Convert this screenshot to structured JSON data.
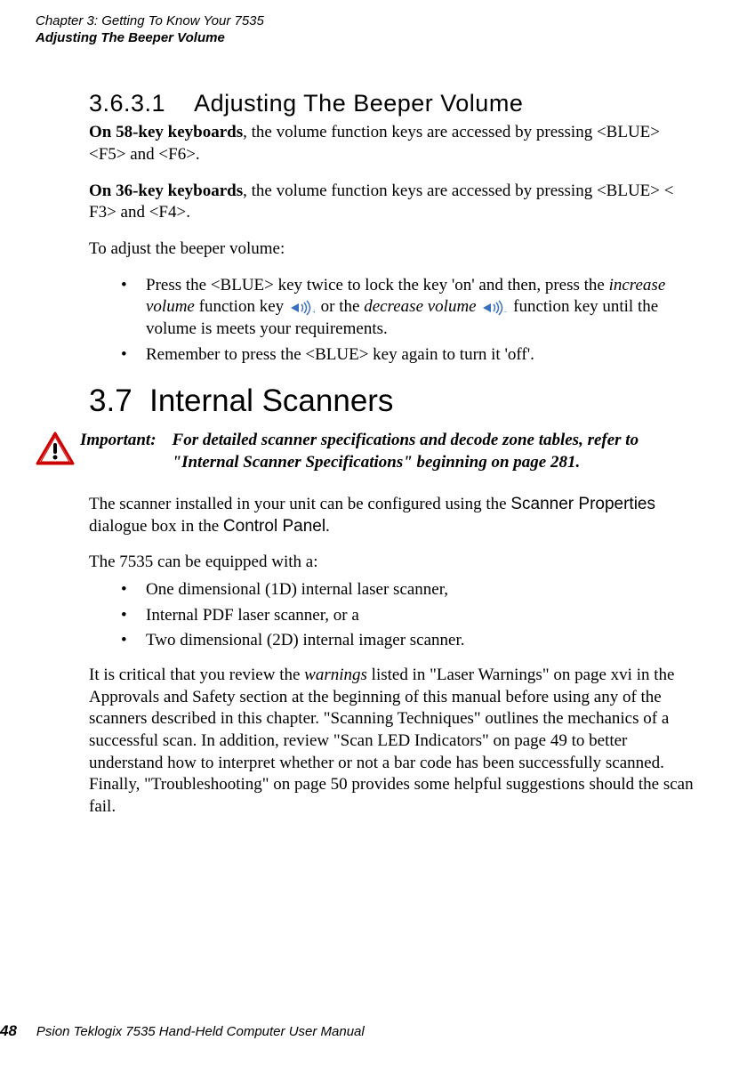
{
  "header": {
    "chapter": "Chapter 3: Getting To Know Your 7535",
    "section": "Adjusting The Beeper Volume"
  },
  "sub": {
    "num": "3.6.3.1",
    "title": "Adjusting The Beeper Volume"
  },
  "p58_bold": "On 58-key keyboards",
  "p58_rest": ", the volume function keys are accessed by pressing <BLUE> <F5> and <F6>.",
  "p36_bold": "On 36-key keyboards",
  "p36_rest": ", the volume function keys are accessed by pressing <BLUE> < F3> and <F4>.",
  "adjust": "To adjust the beeper volume:",
  "b1_a": "Press the <BLUE> key twice to lock the key 'on' and then, press the ",
  "b1_inc": "increase volume",
  "b1_b": " function key ",
  "b1_c": " or the ",
  "b1_dec": "decrease volume",
  "b1_d": " function key until the volume is meets your requirements.",
  "b2": "Remember to press the <BLUE> key again to turn it 'off'.",
  "sec": {
    "num": "3.7",
    "title": "Internal Scanners"
  },
  "imp_label": "Important:",
  "imp_body": "For detailed scanner specifications and decode zone tables, refer to \"Internal Scanner Specifications\" beginning on page 281.",
  "scanner_p1_a": "The scanner installed in your unit can be configured using the ",
  "scanner_p1_b": "Scanner Properties",
  "scanner_p1_c": " dialogue box in the ",
  "scanner_p1_d": "Control Panel",
  "scanner_p1_e": ".",
  "equip": "The 7535 can be equipped with a:",
  "el1": "One dimensional (1D) internal laser scanner,",
  "el2": "Internal PDF laser scanner, or a",
  "el3": "Two dimensional (2D) internal imager scanner.",
  "warn_a": "It is critical that you review the ",
  "warn_b": "warnings",
  "warn_c": " listed in \"Laser Warnings\" on page xvi in the Approvals and Safety section at the beginning of this manual before using any of the scanners described in this chapter. \"Scanning Techniques\" outlines the mechanics of a successful scan. In addition, review \"Scan LED Indicators\" on page 49 to better understand how to interpret whether or not a bar code has been successfully scanned. Finally, \"Troubleshooting\" on page 50 provides some helpful suggestions should the scan fail.",
  "footer": {
    "page": "48",
    "title": "Psion Teklogix 7535 Hand-Held Computer User Manual"
  }
}
